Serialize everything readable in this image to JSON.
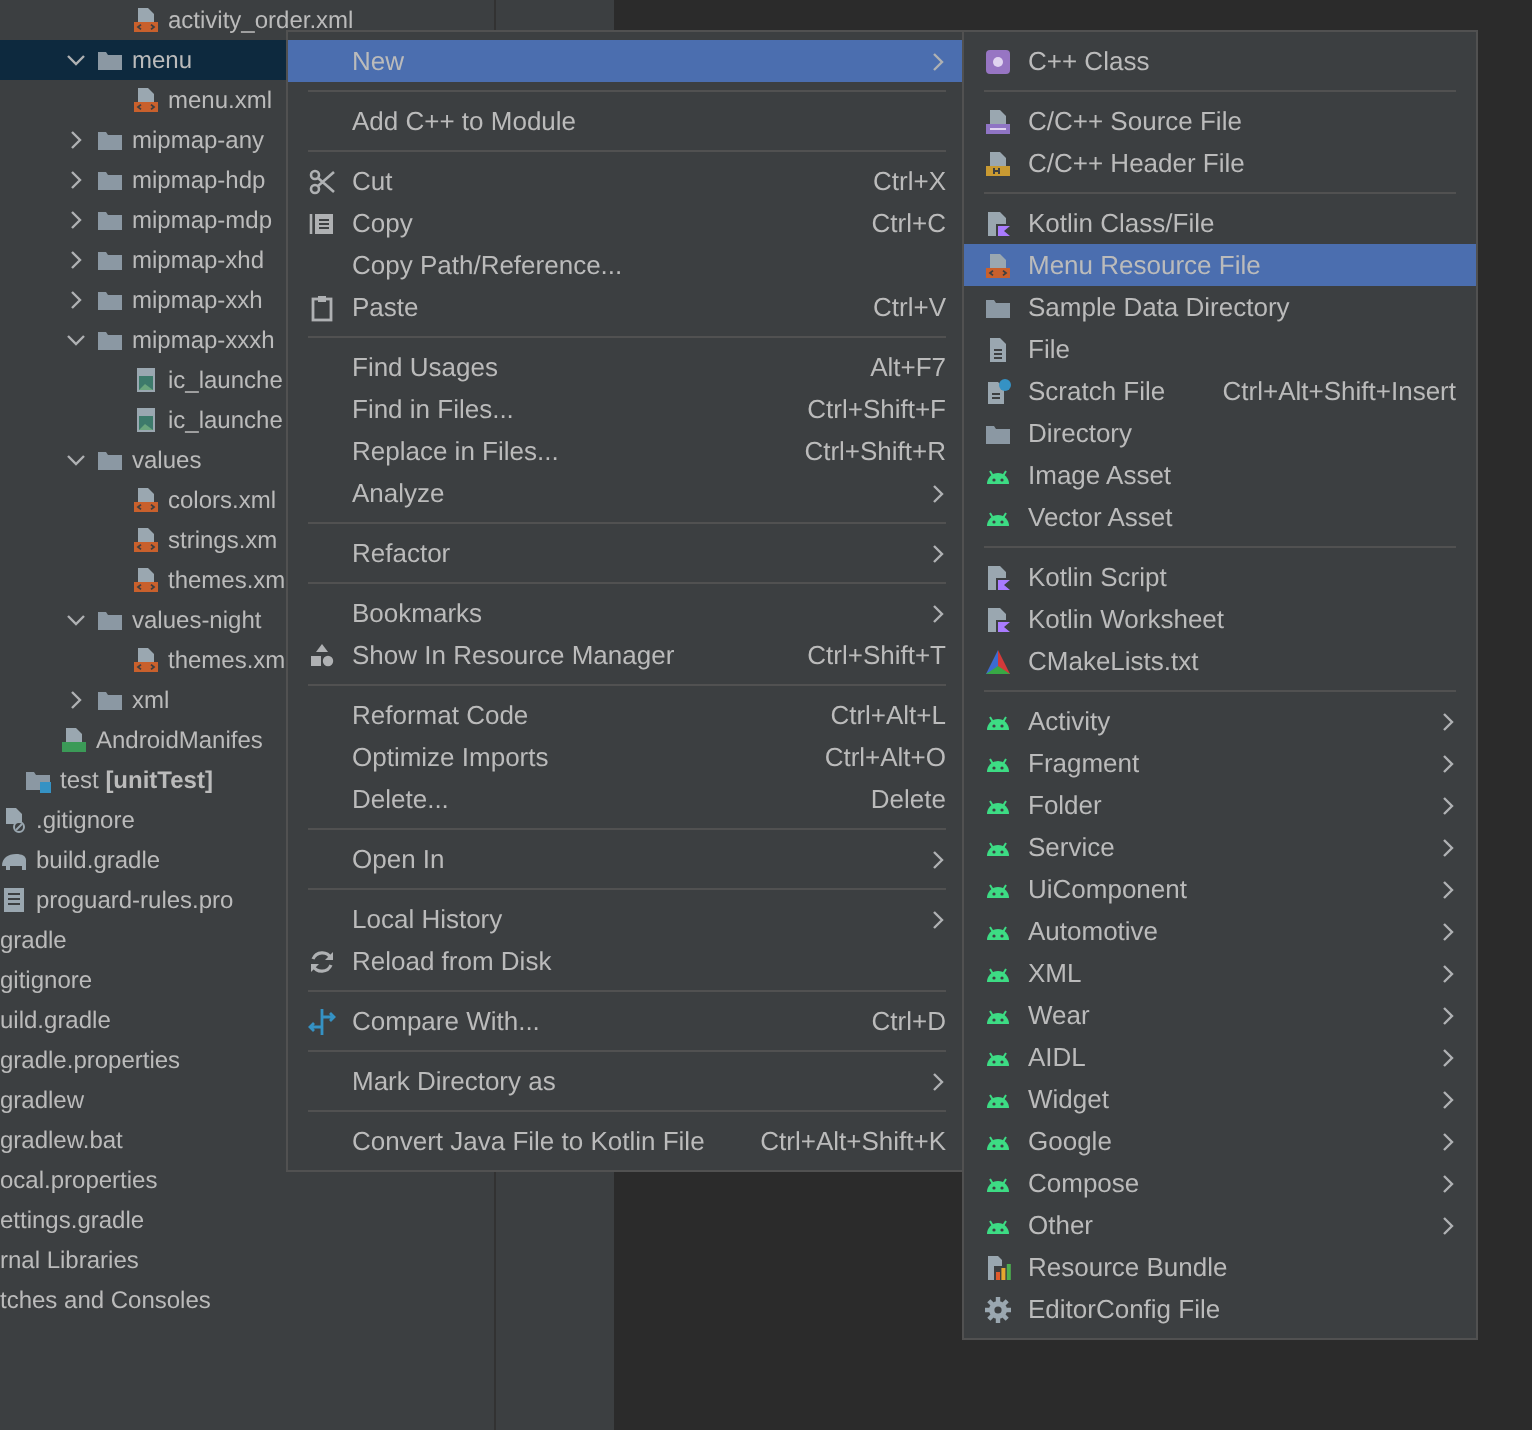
{
  "project_tree": {
    "items": [
      {
        "children": [
          {
            "children": [
              {
                "children": [
                  {
                    "children": [
                      {
                        "children": [
                          {
                            "label": "activity_order.xml",
                            "kind": "xml"
                          }
                        ]
                      },
                      {
                        "label": "menu",
                        "kind": "folder",
                        "expanded": true,
                        "selected": true,
                        "children": [
                          {
                            "label": "menu.xml",
                            "kind": "xml"
                          }
                        ]
                      },
                      {
                        "label": "mipmap-any",
                        "kind": "folder",
                        "expanded": false
                      },
                      {
                        "label": "mipmap-hdp",
                        "kind": "folder",
                        "expanded": false
                      },
                      {
                        "label": "mipmap-mdp",
                        "kind": "folder",
                        "expanded": false
                      },
                      {
                        "label": "mipmap-xhd",
                        "kind": "folder",
                        "expanded": false
                      },
                      {
                        "label": "mipmap-xxh",
                        "kind": "folder",
                        "expanded": false
                      },
                      {
                        "label": "mipmap-xxxh",
                        "kind": "folder",
                        "expanded": true,
                        "children": [
                          {
                            "label": "ic_launche",
                            "kind": "image"
                          },
                          {
                            "label": "ic_launche",
                            "kind": "image"
                          }
                        ]
                      },
                      {
                        "label": "values",
                        "kind": "folder",
                        "expanded": true,
                        "children": [
                          {
                            "label": "colors.xml",
                            "kind": "xml"
                          },
                          {
                            "label": "strings.xm",
                            "kind": "xml"
                          },
                          {
                            "label": "themes.xm",
                            "kind": "xml"
                          }
                        ]
                      },
                      {
                        "label": "values-night",
                        "kind": "folder",
                        "expanded": true,
                        "children": [
                          {
                            "label": "themes.xm",
                            "kind": "xml"
                          }
                        ]
                      },
                      {
                        "label": "xml",
                        "kind": "folder",
                        "expanded": false
                      }
                    ]
                  },
                  {
                    "label": "AndroidManifes",
                    "kind": "manifest"
                  }
                ]
              },
              {
                "label": "test **[unitTest]**",
                "kind": "module"
              }
            ]
          },
          {
            "label": ".gitignore",
            "kind": "ignore"
          },
          {
            "label": "build.gradle",
            "kind": "gradle"
          },
          {
            "label": "proguard-rules.pro",
            "kind": "text"
          }
        ]
      },
      {
        "label": "gradle"
      },
      {
        "label": "gitignore"
      },
      {
        "label": "uild.gradle"
      },
      {
        "label": "gradle.properties"
      },
      {
        "label": "gradlew"
      },
      {
        "label": "gradlew.bat"
      },
      {
        "label": "ocal.properties"
      },
      {
        "label": "ettings.gradle"
      },
      {
        "label": "rnal Libraries"
      },
      {
        "label": "tches and Consoles"
      }
    ]
  },
  "context_menu": {
    "items": [
      {
        "kind": "plain",
        "label": "New",
        "submenu": true,
        "selected": true
      },
      {
        "kind": "separator"
      },
      {
        "kind": "plain",
        "label": "Add C++ to Module",
        "submenu": false,
        "selected": false
      },
      {
        "kind": "separator"
      },
      {
        "kind": "scissors",
        "label": "Cut",
        "shortcut": "Ctrl+X",
        "submenu": false,
        "selected": false
      },
      {
        "kind": "copy",
        "label": "Copy",
        "shortcut": "Ctrl+C",
        "submenu": false,
        "selected": false
      },
      {
        "kind": "plain",
        "label": "Copy Path/Reference...",
        "submenu": false,
        "selected": false
      },
      {
        "kind": "paste",
        "label": "Paste",
        "shortcut": "Ctrl+V",
        "submenu": false,
        "selected": false
      },
      {
        "kind": "separator"
      },
      {
        "kind": "plain",
        "label": "Find Usages",
        "shortcut": "Alt+F7",
        "submenu": false,
        "selected": false
      },
      {
        "kind": "plain",
        "label": "Find in Files...",
        "shortcut": "Ctrl+Shift+F",
        "submenu": false,
        "selected": false
      },
      {
        "kind": "plain",
        "label": "Replace in Files...",
        "shortcut": "Ctrl+Shift+R",
        "submenu": false,
        "selected": false
      },
      {
        "kind": "plain",
        "label": "Analyze",
        "submenu": true,
        "selected": false
      },
      {
        "kind": "separator"
      },
      {
        "kind": "plain",
        "label": "Refactor",
        "submenu": true,
        "selected": false
      },
      {
        "kind": "separator"
      },
      {
        "kind": "plain",
        "label": "Bookmarks",
        "submenu": true,
        "selected": false
      },
      {
        "kind": "shapes",
        "label": "Show In Resource Manager",
        "shortcut": "Ctrl+Shift+T",
        "submenu": false,
        "selected": false
      },
      {
        "kind": "separator"
      },
      {
        "kind": "plain",
        "label": "Reformat Code",
        "shortcut": "Ctrl+Alt+L",
        "submenu": false,
        "selected": false
      },
      {
        "kind": "plain",
        "label": "Optimize Imports",
        "shortcut": "Ctrl+Alt+O",
        "submenu": false,
        "selected": false
      },
      {
        "kind": "plain",
        "label": "Delete...",
        "shortcut": "Delete",
        "submenu": false,
        "selected": false
      },
      {
        "kind": "separator"
      },
      {
        "kind": "plain",
        "label": "Open In",
        "submenu": true,
        "selected": false
      },
      {
        "kind": "separator"
      },
      {
        "kind": "plain",
        "label": "Local History",
        "submenu": true,
        "selected": false
      },
      {
        "kind": "reload",
        "label": "Reload from Disk",
        "submenu": false,
        "selected": false
      },
      {
        "kind": "separator"
      },
      {
        "kind": "compare",
        "label": "Compare With...",
        "shortcut": "Ctrl+D",
        "submenu": false,
        "selected": false
      },
      {
        "kind": "separator"
      },
      {
        "kind": "plain",
        "label": "Mark Directory as",
        "submenu": true,
        "selected": false
      },
      {
        "kind": "separator"
      },
      {
        "kind": "plain",
        "label": "Convert Java File to Kotlin File",
        "shortcut": "Ctrl+Alt+Shift+K",
        "submenu": false,
        "selected": false
      }
    ]
  },
  "new_submenu": {
    "items": [
      {
        "kind": "cppclass",
        "label": "C++ Class",
        "submenu": false,
        "selected": false
      },
      {
        "kind": "separator"
      },
      {
        "kind": "cppfile",
        "label": "C/C++ Source File",
        "submenu": false,
        "selected": false
      },
      {
        "kind": "header",
        "label": "C/C++ Header File",
        "submenu": false,
        "selected": false
      },
      {
        "kind": "separator"
      },
      {
        "kind": "kotlin",
        "label": "Kotlin Class/File",
        "submenu": false,
        "selected": false
      },
      {
        "kind": "xml",
        "label": "Menu Resource File",
        "submenu": false,
        "selected": true
      },
      {
        "kind": "folder",
        "label": "Sample Data Directory",
        "submenu": false,
        "selected": false
      },
      {
        "kind": "file",
        "label": "File",
        "submenu": false,
        "selected": false
      },
      {
        "kind": "scratch",
        "label": "Scratch File",
        "shortcut": "Ctrl+Alt+Shift+Insert",
        "submenu": false,
        "selected": false
      },
      {
        "kind": "folder",
        "label": "Directory",
        "submenu": false,
        "selected": false
      },
      {
        "kind": "android",
        "label": "Image Asset",
        "submenu": false,
        "selected": false
      },
      {
        "kind": "android",
        "label": "Vector Asset",
        "submenu": false,
        "selected": false
      },
      {
        "kind": "separator"
      },
      {
        "kind": "kotlin",
        "label": "Kotlin Script",
        "submenu": false,
        "selected": false
      },
      {
        "kind": "kotlin",
        "label": "Kotlin Worksheet",
        "submenu": false,
        "selected": false
      },
      {
        "kind": "cmake",
        "label": "CMakeLists.txt",
        "submenu": false,
        "selected": false
      },
      {
        "kind": "separator"
      },
      {
        "kind": "android",
        "label": "Activity",
        "submenu": true,
        "selected": false
      },
      {
        "kind": "android",
        "label": "Fragment",
        "submenu": true,
        "selected": false
      },
      {
        "kind": "android",
        "label": "Folder",
        "submenu": true,
        "selected": false
      },
      {
        "kind": "android",
        "label": "Service",
        "submenu": true,
        "selected": false
      },
      {
        "kind": "android",
        "label": "UiComponent",
        "submenu": true,
        "selected": false
      },
      {
        "kind": "android",
        "label": "Automotive",
        "submenu": true,
        "selected": false
      },
      {
        "kind": "android",
        "label": "XML",
        "submenu": true,
        "selected": false
      },
      {
        "kind": "android",
        "label": "Wear",
        "submenu": true,
        "selected": false
      },
      {
        "kind": "android",
        "label": "AIDL",
        "submenu": true,
        "selected": false
      },
      {
        "kind": "android",
        "label": "Widget",
        "submenu": true,
        "selected": false
      },
      {
        "kind": "android",
        "label": "Google",
        "submenu": true,
        "selected": false
      },
      {
        "kind": "android",
        "label": "Compose",
        "submenu": true,
        "selected": false
      },
      {
        "kind": "android",
        "label": "Other",
        "submenu": true,
        "selected": false
      },
      {
        "kind": "bundle",
        "label": "Resource Bundle",
        "submenu": false,
        "selected": false
      },
      {
        "kind": "gear",
        "label": "EditorConfig File",
        "submenu": false,
        "selected": false
      }
    ]
  }
}
